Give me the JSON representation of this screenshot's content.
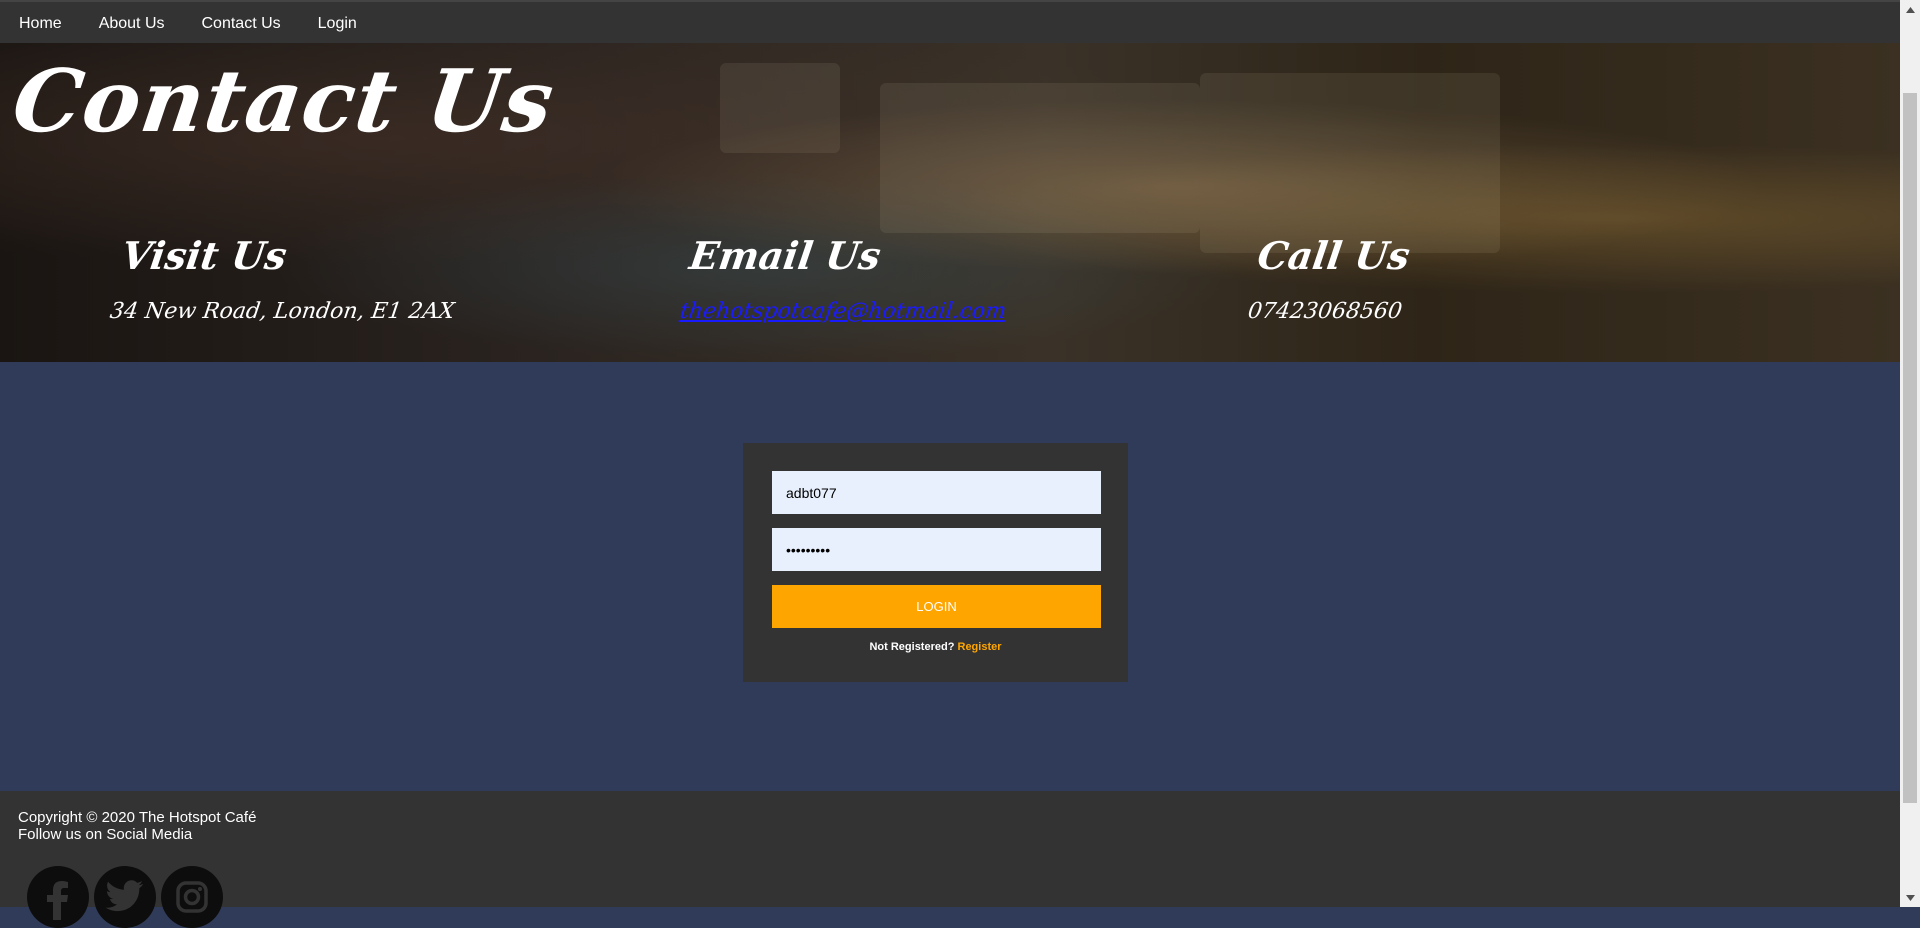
{
  "nav": {
    "items": [
      {
        "label": "Home"
      },
      {
        "label": "About Us"
      },
      {
        "label": "Contact Us"
      },
      {
        "label": "Login"
      }
    ]
  },
  "hero": {
    "title": "Contact Us",
    "visit": {
      "heading": "Visit Us",
      "text": "34 New Road, London, E1 2AX"
    },
    "email": {
      "heading": "Email Us",
      "text": "thehotspotcafe@hotmail.com"
    },
    "call": {
      "heading": "Call Us",
      "text": "07423068560"
    }
  },
  "login": {
    "username_value": "adbt077",
    "password_value": "•••••••••",
    "button_label": "LOGIN",
    "not_registered_text": "Not Registered?",
    "register_link": "Register"
  },
  "footer": {
    "copyright": "Copyright © 2020 The Hotspot Café",
    "follow": "Follow us on Social Media",
    "social": [
      "facebook-icon",
      "twitter-icon",
      "instagram-icon"
    ]
  },
  "colors": {
    "nav_bg": "#333333",
    "body_bg": "#2f3b58",
    "accent": "#ffa500",
    "input_bg": "#e8f0fe",
    "link": "#1a1aff"
  }
}
